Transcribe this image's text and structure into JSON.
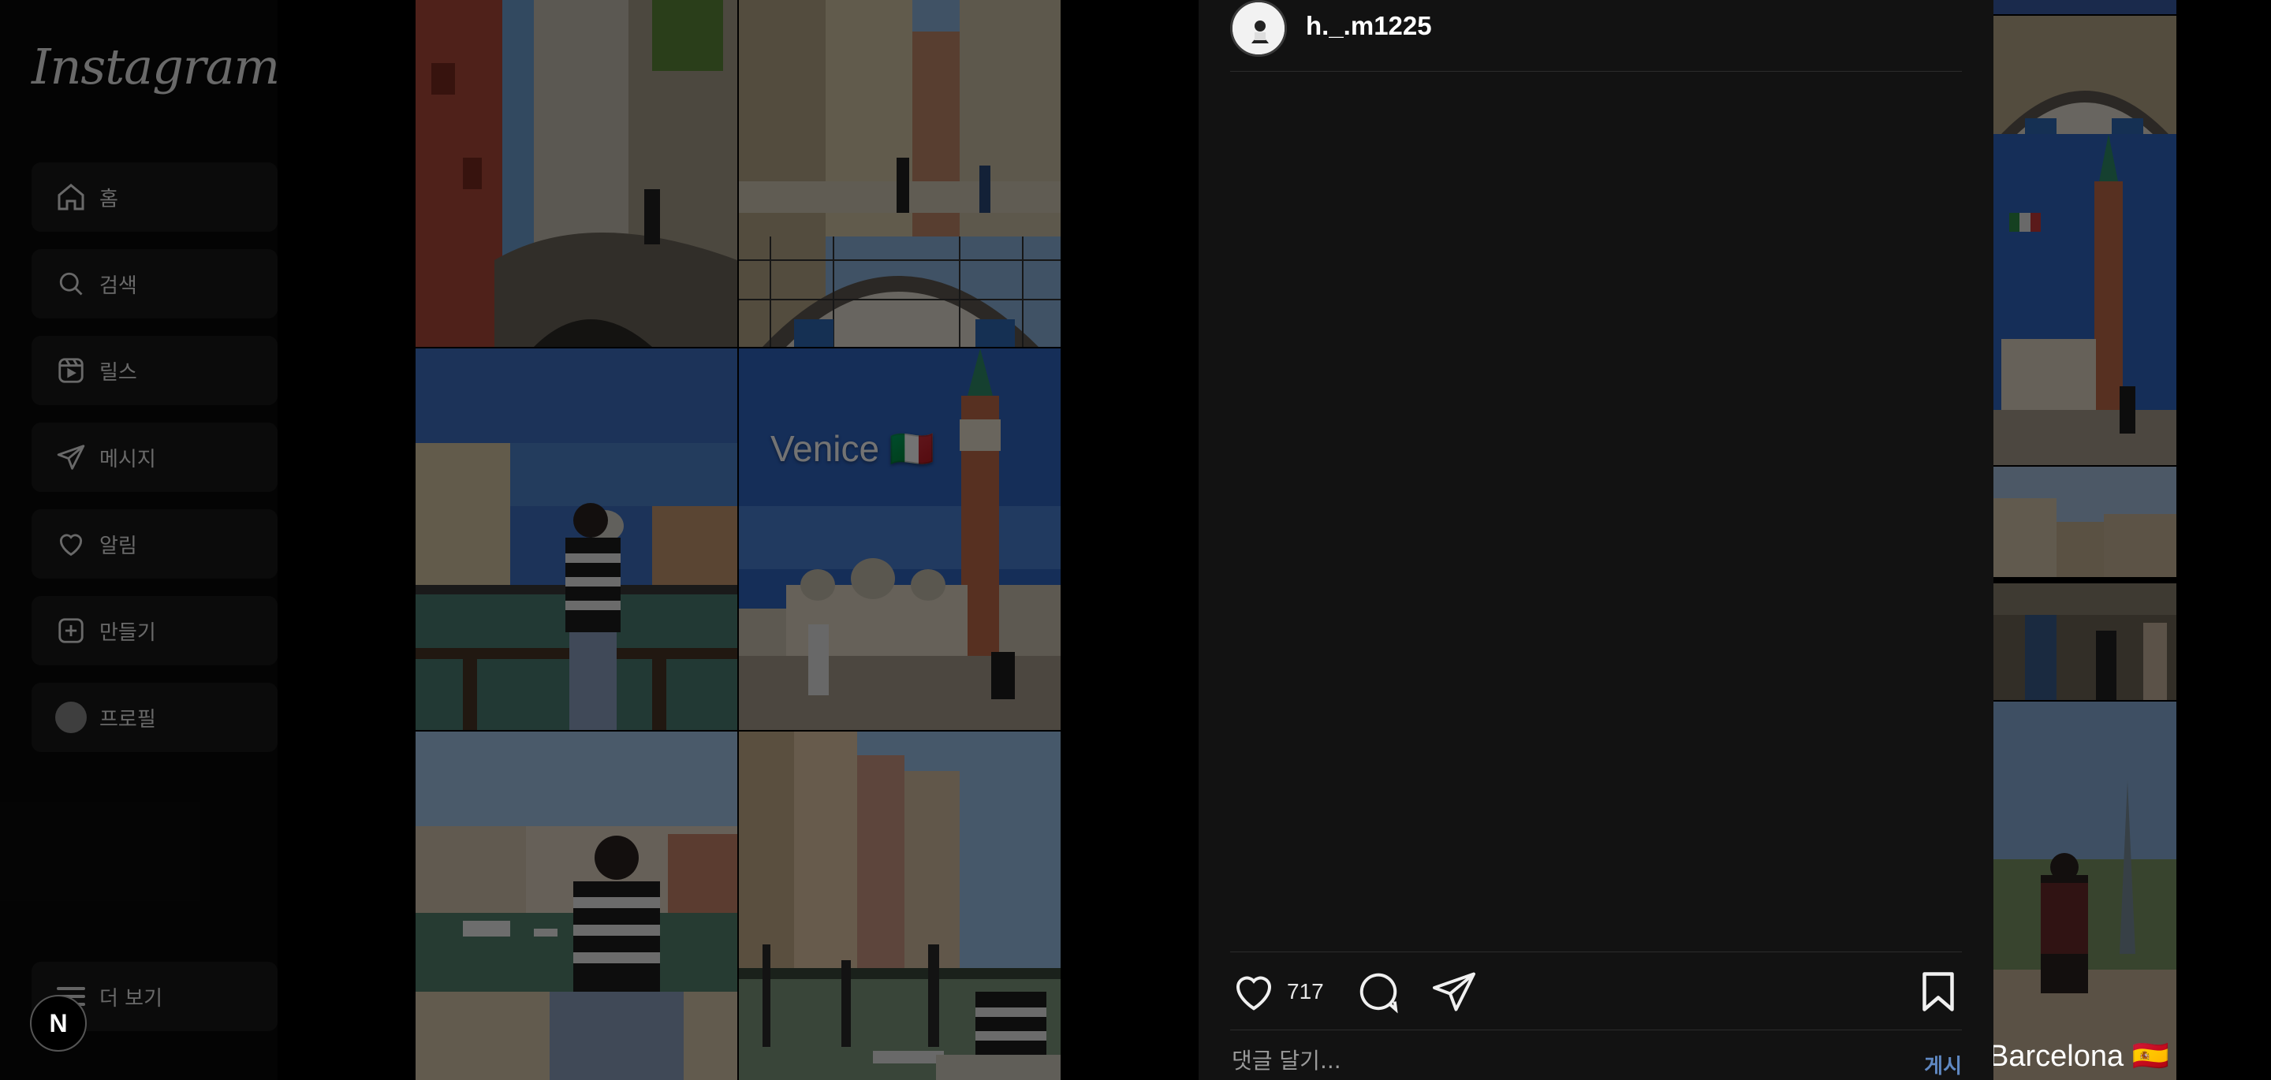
{
  "app": {
    "logo": "Instagram"
  },
  "sidebar": {
    "items": [
      {
        "label": "홈",
        "icon": "home-icon"
      },
      {
        "label": "검색",
        "icon": "search-icon"
      },
      {
        "label": "릴스",
        "icon": "reels-icon"
      },
      {
        "label": "메시지",
        "icon": "send-icon"
      },
      {
        "label": "알림",
        "icon": "heart-icon"
      },
      {
        "label": "만들기",
        "icon": "plus-square-icon"
      },
      {
        "label": "프로필",
        "icon": "profile-avatar"
      }
    ],
    "more": "더 보기",
    "badge": "N"
  },
  "post": {
    "username": "h._.m1225",
    "likes": "717",
    "comment_placeholder": "댓글 달기...",
    "post_button": "게시",
    "photo_captions": {
      "venice": "Venice 🇮🇹"
    }
  },
  "right_thumbnails": {
    "caption": "Barcelona 🇪🇸"
  },
  "colors": {
    "panel": "#121212",
    "accent_link": "#5f88c2",
    "background": "#000000"
  }
}
